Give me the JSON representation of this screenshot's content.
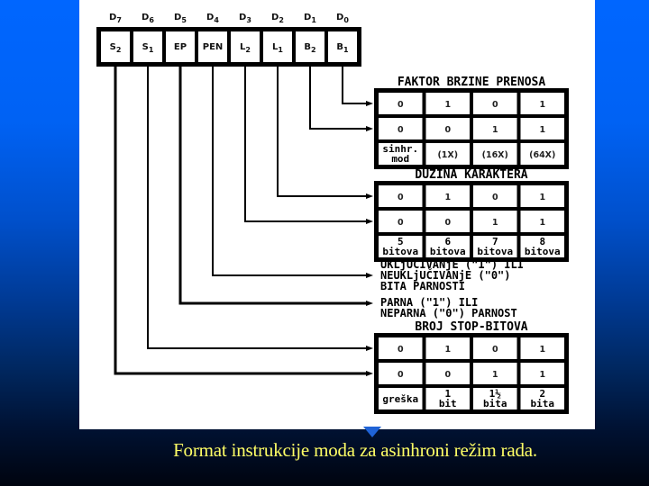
{
  "caption": "Format instrukcije moda za asinhroni režim rada.",
  "colors": {
    "background_top": "#0066ff",
    "background_bottom": "#00040f",
    "panel": "#ffffff",
    "caption": "#ffff66",
    "lines": "#000000"
  },
  "register": {
    "bits": [
      {
        "pos": "D7",
        "field": "S2"
      },
      {
        "pos": "D6",
        "field": "S1"
      },
      {
        "pos": "D5",
        "field": "EP"
      },
      {
        "pos": "D4",
        "field": "PEN"
      },
      {
        "pos": "D3",
        "field": "L2"
      },
      {
        "pos": "D2",
        "field": "L1"
      },
      {
        "pos": "D1",
        "field": "B2"
      },
      {
        "pos": "D0",
        "field": "B1"
      }
    ]
  },
  "tables": {
    "baud": {
      "title": "FAKTOR BRZINE PRENOSA",
      "rows": [
        [
          "0",
          "1",
          "0",
          "1"
        ],
        [
          "0",
          "0",
          "1",
          "1"
        ]
      ],
      "footer": [
        [
          "sinhr.",
          "mod"
        ],
        [
          "(1X)"
        ],
        [
          "(16X)"
        ],
        [
          "(64X)"
        ]
      ]
    },
    "length": {
      "title": "DUŽINA KARAKTERA",
      "rows": [
        [
          "0",
          "1",
          "0",
          "1"
        ],
        [
          "0",
          "0",
          "1",
          "1"
        ]
      ],
      "footer": [
        [
          "5",
          "bitova"
        ],
        [
          "6",
          "bitova"
        ],
        [
          "7",
          "bitova"
        ],
        [
          "8",
          "bitova"
        ]
      ]
    },
    "stop": {
      "title": "BROJ STOP-BITOVA",
      "rows": [
        [
          "0",
          "1",
          "0",
          "1"
        ],
        [
          "0",
          "0",
          "1",
          "1"
        ]
      ],
      "footer": [
        [
          "greška"
        ],
        [
          "1",
          "bit"
        ],
        [
          "1½",
          "bita"
        ],
        [
          "2",
          "bita"
        ]
      ]
    }
  },
  "descriptions": {
    "pen": [
      "UKLjUČIVANjE (\"1\") ILI",
      "NEUKLjUČIVANjE (\"0\")",
      "BITA PARNOSTI"
    ],
    "ep": [
      "PARNA (\"1\") ILI",
      "NEPARNA (\"0\") PARNOST"
    ]
  }
}
